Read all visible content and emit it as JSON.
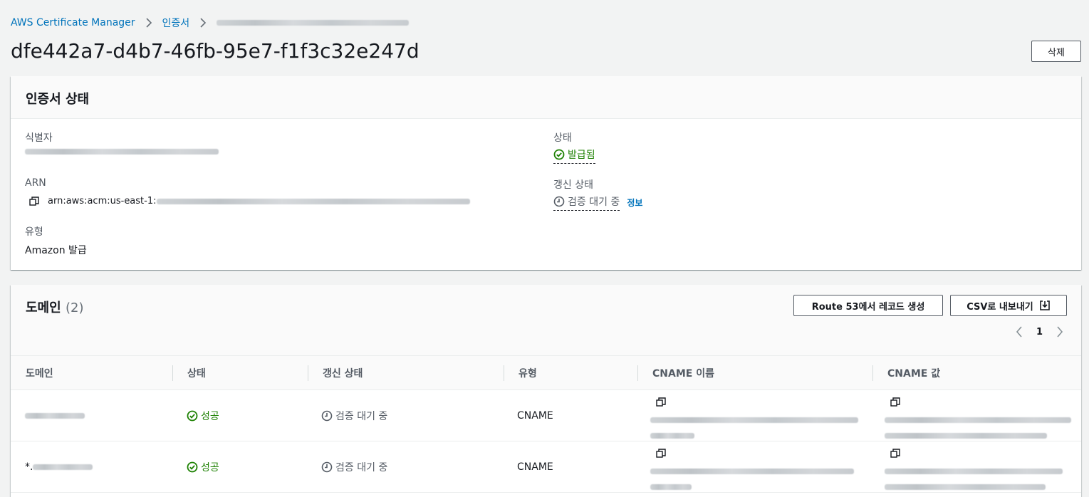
{
  "breadcrumb": {
    "root": "AWS Certificate Manager",
    "parent": "인증서"
  },
  "page": {
    "title": "dfe442a7-d4b7-46fb-95e7-f1f3c32e247d",
    "delete_label": "삭제"
  },
  "cert_status": {
    "heading": "인증서 상태",
    "identifier_label": "식별자",
    "arn_label": "ARN",
    "arn_prefix": "arn:aws:acm:us-east-1:",
    "type_label": "유형",
    "type_value": "Amazon 발급",
    "status_label": "상태",
    "status_value": "발급됨",
    "renewal_label": "갱신 상태",
    "renewal_value": "검증 대기 중",
    "info_label": "정보"
  },
  "domains": {
    "heading": "도메인",
    "count": "(2)",
    "route53_label": "Route 53에서 레코드 생성",
    "csv_label": "CSV로 내보내기",
    "page_number": "1",
    "columns": [
      "도메인",
      "상태",
      "갱신 상태",
      "유형",
      "CNAME 이름",
      "CNAME 값"
    ],
    "rows": [
      {
        "domain_prefix": "",
        "status": "성공",
        "renewal": "검증 대기 중",
        "type": "CNAME"
      },
      {
        "domain_prefix": "*.",
        "status": "성공",
        "renewal": "검증 대기 중",
        "type": "CNAME"
      }
    ]
  },
  "colors": {
    "link": "#0073bb",
    "success": "#1d8102",
    "background": "#f2f3f3"
  },
  "icons": [
    "chevron-right-icon",
    "check-circle-icon",
    "clock-icon",
    "copy-icon",
    "download-icon",
    "chevron-left-icon"
  ]
}
